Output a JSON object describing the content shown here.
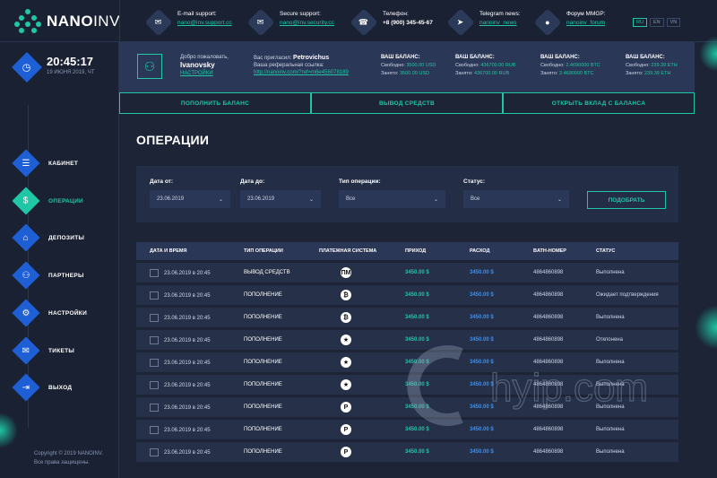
{
  "brand": {
    "name_bold": "NANO",
    "name_light": "INV"
  },
  "contacts": [
    {
      "icon": "mail-icon",
      "glyph": "✉",
      "label": "E-mail support:",
      "value": "nano@inv.support.cc",
      "link": true
    },
    {
      "icon": "mail-icon",
      "glyph": "✉",
      "label": "Secure support:",
      "value": "nano@inv.security.cc",
      "link": true
    },
    {
      "icon": "phone-icon",
      "glyph": "☎",
      "label": "Телефон:",
      "value": "+8 (900) 345-45-67",
      "link": false
    },
    {
      "icon": "telegram-icon",
      "glyph": "➤",
      "label": "Telegram news:",
      "value": "nanoinv_news",
      "link": true
    },
    {
      "icon": "forum-icon",
      "glyph": "●",
      "label": "Форум MMGP:",
      "value": "nanoinv_forum",
      "link": true
    }
  ],
  "languages": [
    "RU",
    "EN",
    "VN"
  ],
  "clock": {
    "time": "20:45:17",
    "date": "19 ИЮНЯ 2019, ЧТ"
  },
  "nav": [
    {
      "key": "cabinet",
      "label": "КАБИНЕТ",
      "glyph": "☰",
      "active": false
    },
    {
      "key": "operations",
      "label": "ОПЕРАЦИИ",
      "glyph": "$",
      "active": true
    },
    {
      "key": "deposits",
      "label": "ДЕПОЗИТЫ",
      "glyph": "⌂",
      "active": false
    },
    {
      "key": "partners",
      "label": "ПАРТНЕРЫ",
      "glyph": "⚇",
      "active": false
    },
    {
      "key": "settings",
      "label": "НАСТРОЙКИ",
      "glyph": "⚙",
      "active": false
    },
    {
      "key": "tickets",
      "label": "ТИКЕТЫ",
      "glyph": "✉",
      "active": false
    },
    {
      "key": "exit",
      "label": "ВЫХОД",
      "glyph": "⇥",
      "active": false
    }
  ],
  "copyright": {
    "line1": "Copyright © 2019 NANOINV.",
    "line2": "Все права защищены."
  },
  "welcome": {
    "greeting": "Добро пожаловать,",
    "username": "Ivanovsky",
    "settings_link": "НАСТРОЙКИ",
    "invited_label": "Вас пригласил:",
    "invited_by": "Petrovichus",
    "ref_label": "Ваша реферальная ссылка:",
    "ref_link": "http://nanoinv.com/?ref=m6e456078189"
  },
  "balances": [
    {
      "title": "ВАШ БАЛАНС:",
      "free_label": "Свободно:",
      "free": "3500.00 USD",
      "busy_label": "Занято:",
      "busy": "3500.00 USD"
    },
    {
      "title": "ВАШ БАЛАНС:",
      "free_label": "Свободно:",
      "free": "436700.00 RUB",
      "busy_label": "Занято:",
      "busy": "436700.00 RUB"
    },
    {
      "title": "ВАШ БАЛАНС:",
      "free_label": "Свободно:",
      "free": "2.4690000 BTC",
      "busy_label": "Занято:",
      "busy": "2.4690000 BTC"
    },
    {
      "title": "ВАШ БАЛАНС:",
      "free_label": "Свободно:",
      "free": "239.39 ETH",
      "busy_label": "Занято:",
      "busy": "239.39 ETH"
    }
  ],
  "actions": {
    "topup": "ПОПОЛНИТЬ БАЛАНС",
    "withdraw": "ВЫВОД СРЕДСТВ",
    "open_deposit": "ОТКРЫТЬ ВКЛАД С БАЛАНСА"
  },
  "page_title": "ОПЕРАЦИИ",
  "filter": {
    "date_from_label": "Дата от:",
    "date_from": "23.06.2019",
    "date_to_label": "Дата до:",
    "date_to": "23.06.2019",
    "type_label": "Тип операции:",
    "type_value": "Все",
    "status_label": "Статус:",
    "status_value": "Все",
    "submit": "ПОДОБРАТЬ"
  },
  "table": {
    "headers": [
      "ДАТА И ВРЕМЯ",
      "ТИП ОПЕРАЦИИ",
      "ПЛАТЕЖНАЯ СИСТЕМА",
      "ПРИХОД",
      "РАСХОД",
      "BATH-НОМЕР",
      "СТАТУС"
    ],
    "rows": [
      {
        "date": "23.06.2019 в 20:45",
        "type": "ВЫВОД СРЕДСТВ",
        "system": "ПМ",
        "income": "3450.00 $",
        "expense": "3450.00 $",
        "batch": "4864860898",
        "status": "Выполнена"
      },
      {
        "date": "23.06.2019 в 20:45",
        "type": "ПОПОЛНЕНИЕ",
        "system": "₿",
        "income": "3450.00 $",
        "expense": "3450.00 $",
        "batch": "4864860898",
        "status": "Ожидает подтверждения"
      },
      {
        "date": "23.06.2019 в 20:45",
        "type": "ПОПОЛНЕНИЕ",
        "system": "₿",
        "income": "3450.00 $",
        "expense": "3450.00 $",
        "batch": "4864860898",
        "status": "Выполнена"
      },
      {
        "date": "23.06.2019 в 20:45",
        "type": "ПОПОЛНЕНИЕ",
        "system": "★",
        "income": "3450.00 $",
        "expense": "3450.00 $",
        "batch": "4864860898",
        "status": "Откпонена"
      },
      {
        "date": "23.06.2019 в 20:45",
        "type": "ПОПОЛНЕНИЕ",
        "system": "★",
        "income": "3450.00 $",
        "expense": "3450.00 $",
        "batch": "4864860898",
        "status": "Выполнена"
      },
      {
        "date": "23.06.2019 в 20:45",
        "type": "ПОПОЛНЕНИЕ",
        "system": "★",
        "income": "3450.00 $",
        "expense": "3450.00 $",
        "batch": "4864860898",
        "status": "Выполнена"
      },
      {
        "date": "23.06.2019 в 20:45",
        "type": "ПОПОЛНЕНИЕ",
        "system": "P",
        "income": "3450.00 $",
        "expense": "3450.00 $",
        "batch": "4864860898",
        "status": "Выполнена"
      },
      {
        "date": "23.06.2019 в 20:45",
        "type": "ПОПОЛНЕНИЕ",
        "system": "P",
        "income": "3450.00 $",
        "expense": "3450.00 $",
        "batch": "4864860898",
        "status": "Выполнена"
      },
      {
        "date": "23.06.2019 в 20:45",
        "type": "ПОПОЛНЕНИЕ",
        "system": "P",
        "income": "3450.00 $",
        "expense": "3450.00 $",
        "batch": "4864860898",
        "status": "Выполнена"
      }
    ]
  },
  "watermark": "hyip.com",
  "colors": {
    "accent": "#1fc7a6",
    "blue": "#1f5fd6",
    "expense": "#3c8ff0",
    "bg": "#1c2436"
  }
}
